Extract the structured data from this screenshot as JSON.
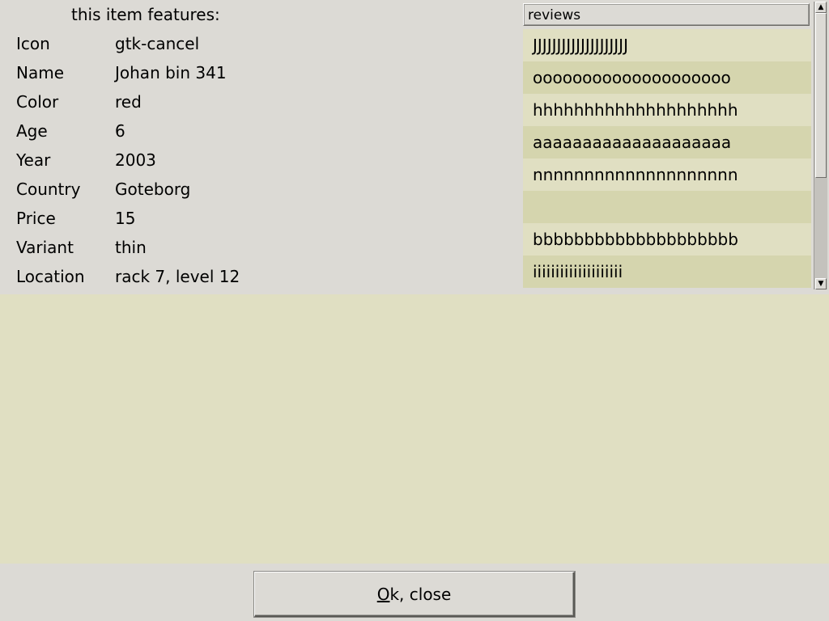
{
  "features": {
    "title": "this item features:",
    "rows": [
      {
        "key": "Icon",
        "value": "gtk-cancel"
      },
      {
        "key": "Name",
        "value": "Johan bin 341"
      },
      {
        "key": "Color",
        "value": "red"
      },
      {
        "key": "Age",
        "value": "6"
      },
      {
        "key": "Year",
        "value": "2003"
      },
      {
        "key": "Country",
        "value": "Goteborg"
      },
      {
        "key": "Price",
        "value": "15"
      },
      {
        "key": "Variant",
        "value": "thin"
      },
      {
        "key": "Location",
        "value": "rack 7, level 12"
      }
    ]
  },
  "reviews": {
    "header": "reviews",
    "items": [
      "JJJJJJJJJJJJJJJJJJJJ",
      "oooooooooooooooooooo",
      "hhhhhhhhhhhhhhhhhhhh",
      "aaaaaaaaaaaaaaaaaaaa",
      "nnnnnnnnnnnnnnnnnnnn",
      "",
      "bbbbbbbbbbbbbbbbbbbb",
      "iiiiiiiiiiiiiiiiiiii"
    ]
  },
  "dialog": {
    "ok_mnemonic": "O",
    "ok_rest": "k, close"
  },
  "icons": {
    "scroll_up": "arrow-up-icon",
    "scroll_down": "arrow-down-icon"
  }
}
